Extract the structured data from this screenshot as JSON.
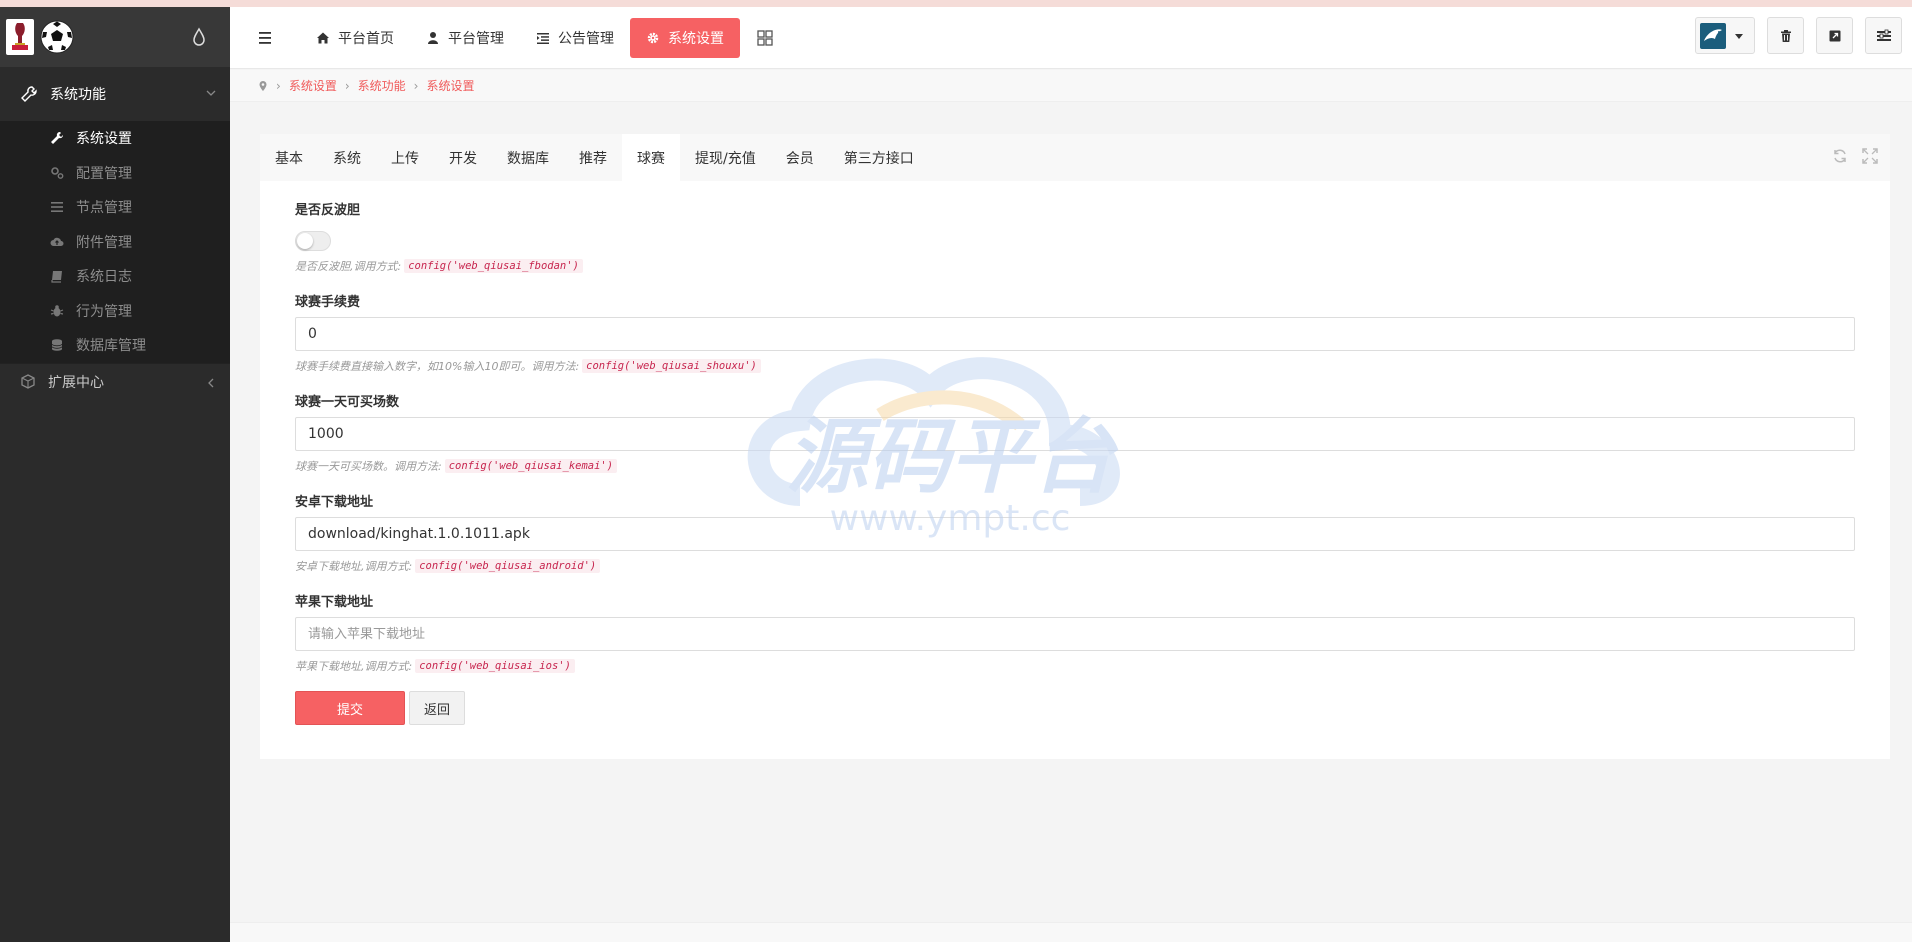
{
  "sidebar": {
    "group_system": "系统功能",
    "items": [
      {
        "label": "系统设置"
      },
      {
        "label": "配置管理"
      },
      {
        "label": "节点管理"
      },
      {
        "label": "附件管理"
      },
      {
        "label": "系统日志"
      },
      {
        "label": "行为管理"
      },
      {
        "label": "数据库管理"
      }
    ],
    "group_extension": "扩展中心"
  },
  "header": {
    "nav": [
      {
        "label": "平台首页"
      },
      {
        "label": "平台管理"
      },
      {
        "label": "公告管理"
      },
      {
        "label": "系统设置"
      }
    ]
  },
  "breadcrumb": [
    "系统设置",
    "系统功能",
    "系统设置"
  ],
  "tabs": [
    "基本",
    "系统",
    "上传",
    "开发",
    "数据库",
    "推荐",
    "球赛",
    "提现/充值",
    "会员",
    "第三方接口"
  ],
  "active_tab": "球赛",
  "form": {
    "fbodan": {
      "label": "是否反波胆",
      "help": "是否反波胆,调用方式:",
      "code": "config('web_qiusai_fbodan')",
      "enabled": false
    },
    "shouxu": {
      "label": "球赛手续费",
      "value": "0",
      "help": "球赛手续费直接输入数字，如10%输入10即可。调用方法:",
      "code": "config('web_qiusai_shouxu')"
    },
    "kemai": {
      "label": "球赛一天可买场数",
      "value": "1000",
      "help": "球赛一天可买场数。调用方法:",
      "code": "config('web_qiusai_kemai')"
    },
    "android": {
      "label": "安卓下载地址",
      "value": "download/kinghat.1.0.1011.apk",
      "help": "安卓下载地址,调用方式:",
      "code": "config('web_qiusai_android')"
    },
    "ios": {
      "label": "苹果下载地址",
      "value": "",
      "placeholder": "请输入苹果下载地址",
      "help": "苹果下载地址,调用方式:",
      "code": "config('web_qiusai_ios')"
    },
    "submit": "提交",
    "back": "返回"
  },
  "watermark": {
    "title": "源码平台",
    "url": "www.ympt.cc"
  },
  "colors": {
    "accent": "#f66163",
    "sidebar_bg": "#2b2b2b",
    "code_text": "#c7254e"
  }
}
